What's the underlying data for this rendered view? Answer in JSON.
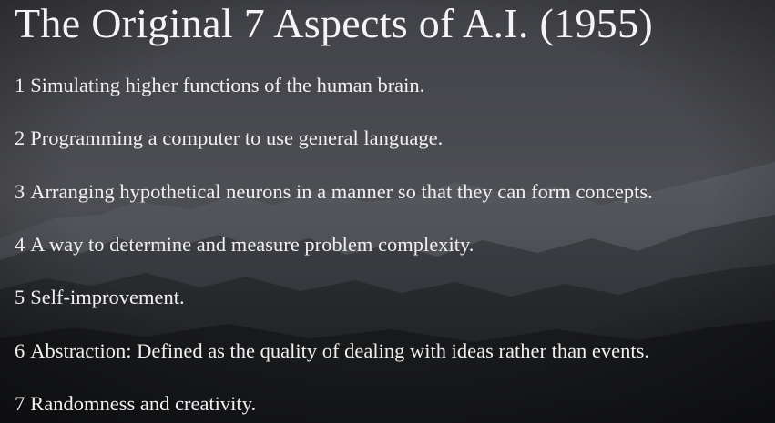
{
  "slide": {
    "title": "The Original 7 Aspects of A.I. (1955)",
    "items": [
      {
        "number": "1",
        "text": "Simulating higher functions of the human brain."
      },
      {
        "number": "2",
        "text": "Programming a computer to use general language."
      },
      {
        "number": "3",
        "text": "Arranging hypothetical neurons in a manner so that they can form concepts."
      },
      {
        "number": "4",
        "text": "A way to determine and measure problem complexity."
      },
      {
        "number": "5",
        "text": "Self-improvement."
      },
      {
        "number": "6",
        "text": "Abstraction: Defined as the quality of dealing with ideas rather than events."
      },
      {
        "number": "7",
        "text": "Randomness and creativity."
      }
    ]
  },
  "background": {
    "image": "mountain-landscape",
    "sky_color": "#4a4b50",
    "mountain_color": "#2a2c31",
    "foreground_color": "#1d1e22"
  }
}
